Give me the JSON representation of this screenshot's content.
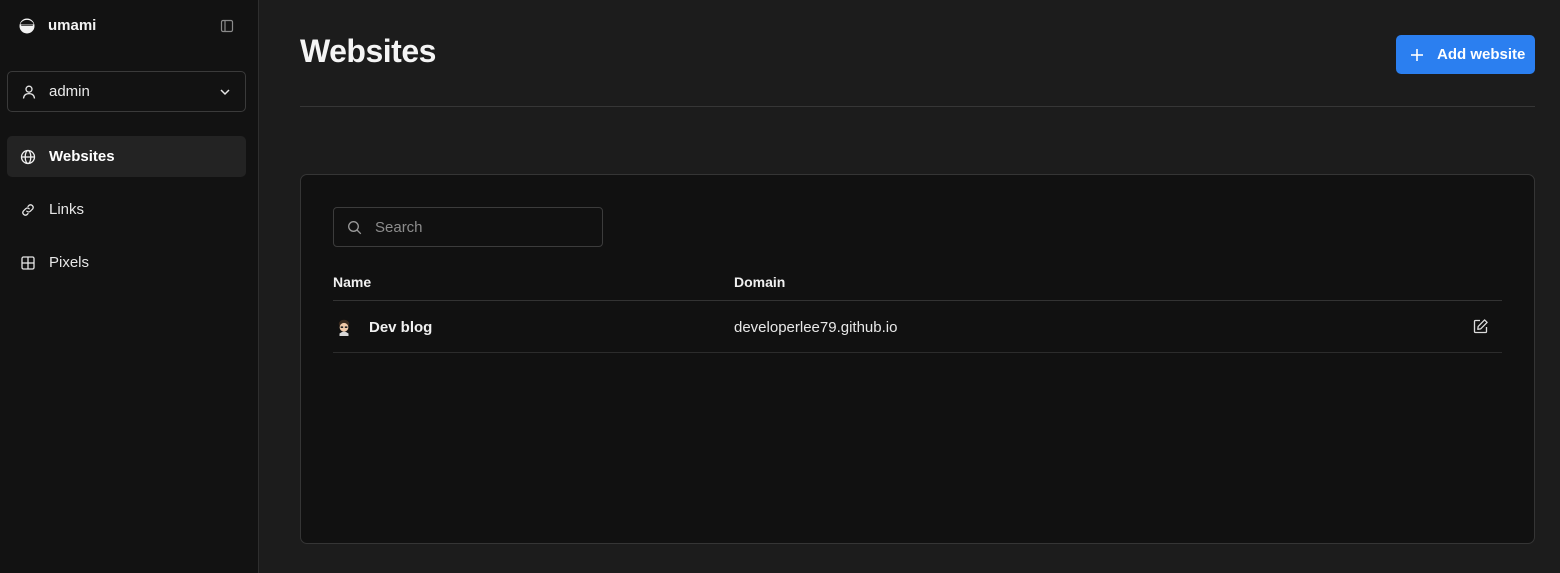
{
  "app": {
    "name": "umami"
  },
  "account": {
    "label": "admin"
  },
  "nav": {
    "items": [
      {
        "label": "Websites",
        "icon": "globe-icon",
        "active": true
      },
      {
        "label": "Links",
        "icon": "link-icon",
        "active": false
      },
      {
        "label": "Pixels",
        "icon": "grid-icon",
        "active": false
      }
    ]
  },
  "page": {
    "title": "Websites",
    "add_button_label": "Add website"
  },
  "search": {
    "placeholder": "Search",
    "value": ""
  },
  "table": {
    "columns": [
      "Name",
      "Domain"
    ],
    "rows": [
      {
        "name": "Dev blog",
        "domain": "developerlee79.github.io",
        "avatar": "cartoon-avatar-icon"
      }
    ]
  },
  "colors": {
    "accent": "#2b7ff0",
    "sidebar_bg": "#121212",
    "main_bg": "#1c1c1c",
    "panel_bg": "#111111"
  }
}
